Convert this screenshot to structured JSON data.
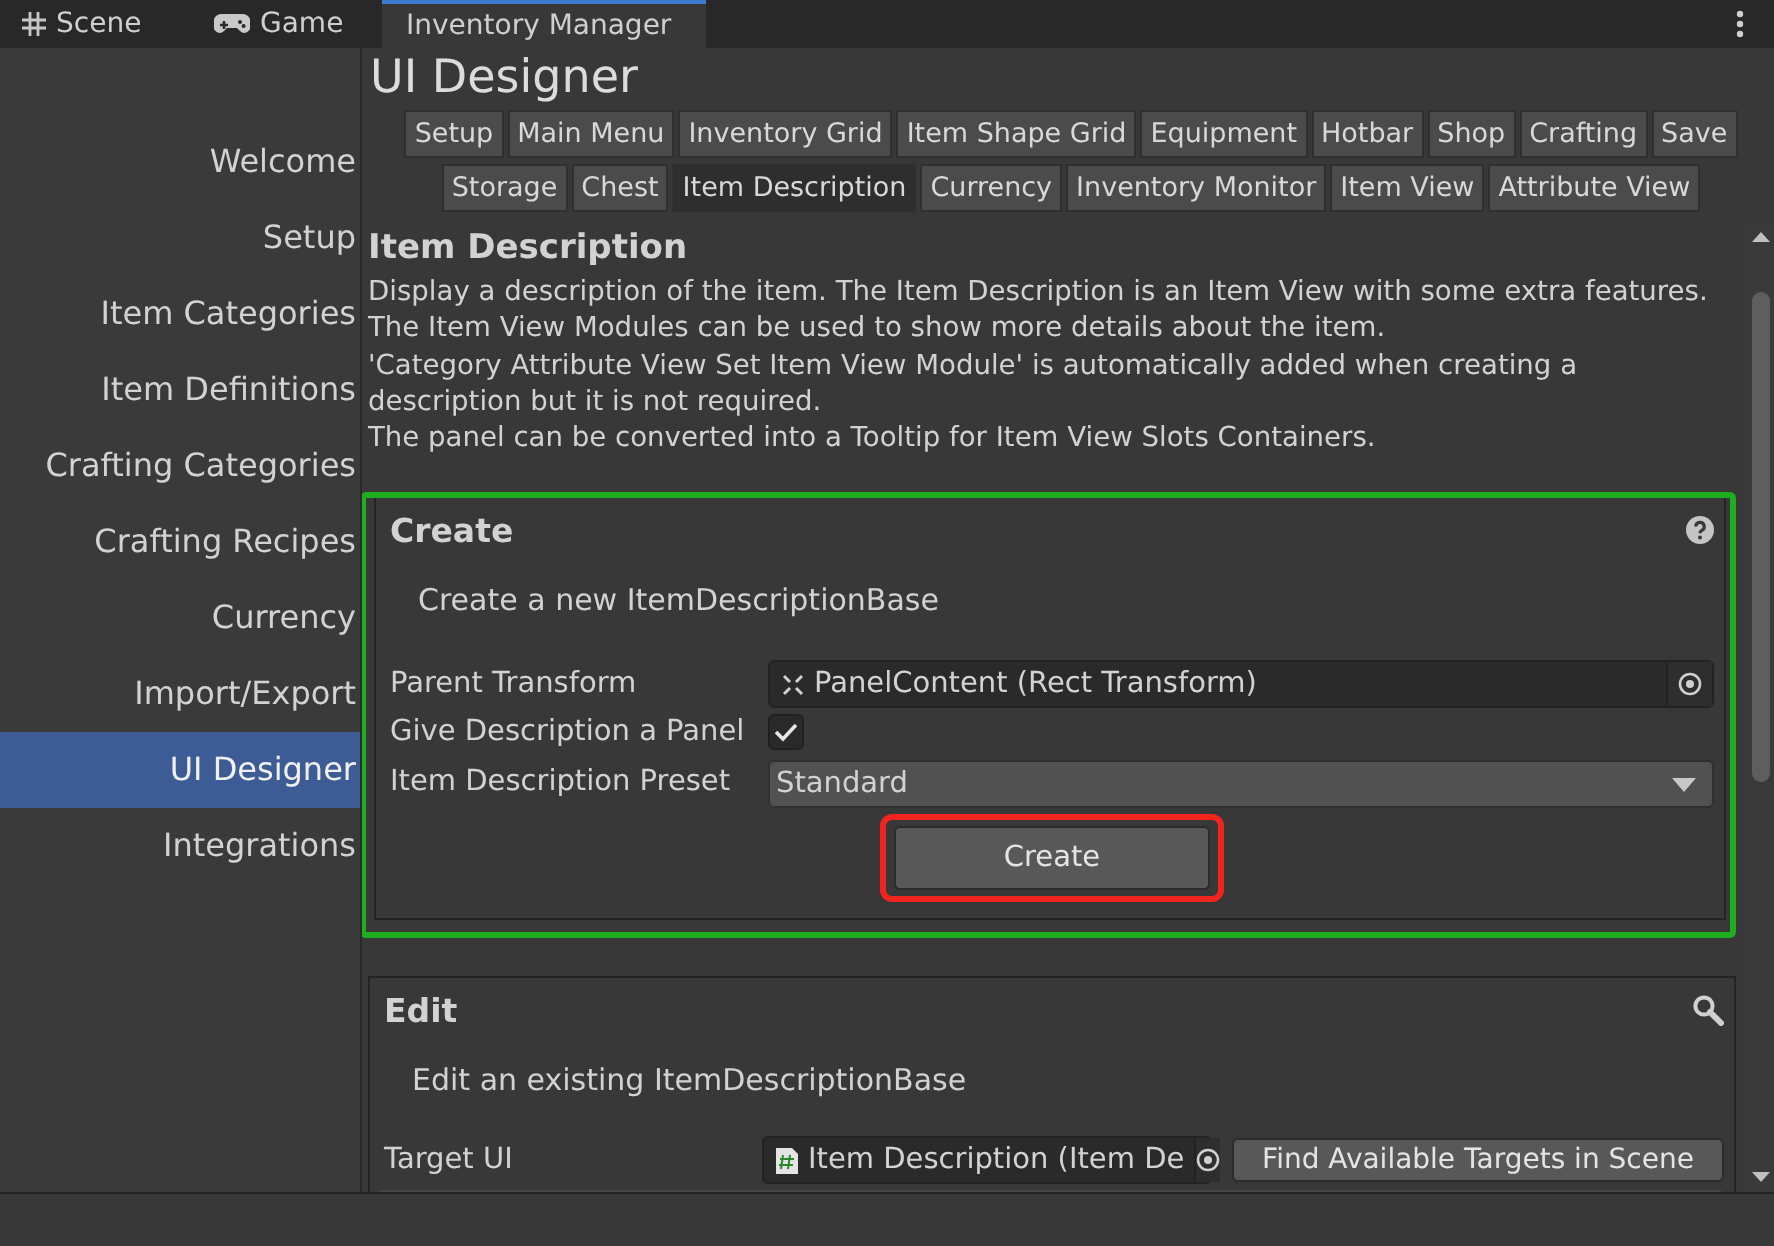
{
  "window_tabs": [
    {
      "label": "Scene",
      "selected": false
    },
    {
      "label": "Game",
      "selected": false
    },
    {
      "label": "Inventory Manager",
      "selected": true
    }
  ],
  "sidebar": {
    "items": [
      {
        "label": "Welcome",
        "selected": false
      },
      {
        "label": "Setup",
        "selected": false
      },
      {
        "label": "Item Categories",
        "selected": false
      },
      {
        "label": "Item Definitions",
        "selected": false
      },
      {
        "label": "Crafting Categories",
        "selected": false
      },
      {
        "label": "Crafting Recipes",
        "selected": false
      },
      {
        "label": "Currency",
        "selected": false
      },
      {
        "label": "Import/Export",
        "selected": false
      },
      {
        "label": "UI Designer",
        "selected": true
      },
      {
        "label": "Integrations",
        "selected": false
      }
    ]
  },
  "title": "UI Designer",
  "section_tab_rows": [
    {
      "tabs": [
        {
          "label": "Setup",
          "selected": false
        },
        {
          "label": "Main Menu",
          "selected": false
        },
        {
          "label": "Inventory Grid",
          "selected": false
        },
        {
          "label": "Item Shape Grid",
          "selected": false
        },
        {
          "label": "Equipment",
          "selected": false
        },
        {
          "label": "Hotbar",
          "selected": false
        },
        {
          "label": "Shop",
          "selected": false
        },
        {
          "label": "Crafting",
          "selected": false
        },
        {
          "label": "Save",
          "selected": false
        }
      ]
    },
    {
      "tabs": [
        {
          "label": "Storage",
          "selected": false
        },
        {
          "label": "Chest",
          "selected": false
        },
        {
          "label": "Item Description",
          "selected": true
        },
        {
          "label": "Currency",
          "selected": false
        },
        {
          "label": "Inventory Monitor",
          "selected": false
        },
        {
          "label": "Item View",
          "selected": false
        },
        {
          "label": "Attribute View",
          "selected": false
        }
      ]
    }
  ],
  "heading": "Item Description",
  "description": [
    "Display a description of the item. The Item Description is an Item View with some extra features.",
    "The Item View Modules can be used to show more details about the item.",
    "'Category Attribute View Set Item View Module' is automatically added when creating a description but it is not required.",
    "The panel can be converted into a Tooltip for Item View Slots Containers."
  ],
  "create_panel": {
    "title": "Create",
    "highlighted": true,
    "subtitle": "Create a new ItemDescriptionBase",
    "fields": [
      {
        "kind": "object",
        "label": "Parent Transform",
        "value": "PanelContent (Rect Transform)"
      },
      {
        "kind": "checkbox",
        "label": "Give Description a Panel",
        "checked": true
      },
      {
        "kind": "dropdown",
        "label": "Item Description Preset",
        "value": "Standard"
      }
    ],
    "button": {
      "label": "Create",
      "highlighted": true
    }
  },
  "edit_panel": {
    "title": "Edit",
    "subtitle": "Edit an existing ItemDescriptionBase",
    "target": {
      "label": "Target UI",
      "value": "Item Description (Item De",
      "button": "Find Available Targets in Scene"
    }
  }
}
